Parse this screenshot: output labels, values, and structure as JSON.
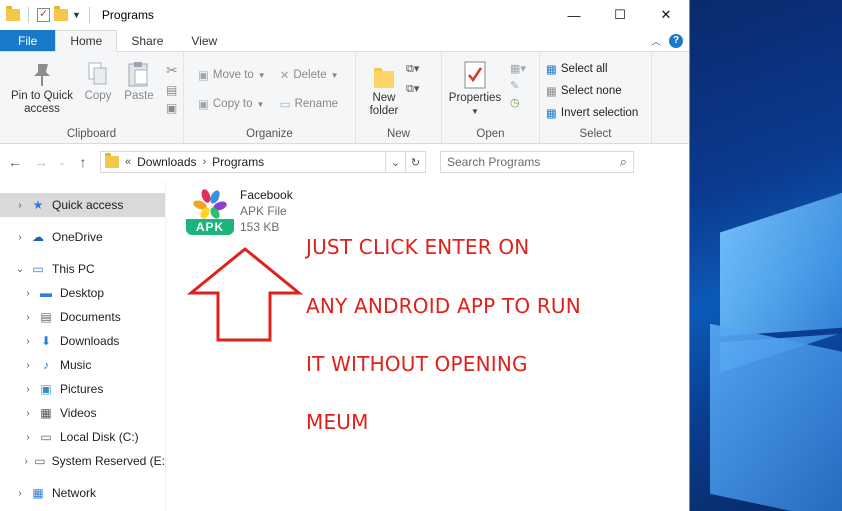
{
  "window": {
    "title": "Programs",
    "controls": {
      "minimize": "—",
      "maximize": "☐",
      "close": "✕"
    }
  },
  "tabs": [
    {
      "label": "File"
    },
    {
      "label": "Home"
    },
    {
      "label": "Share"
    },
    {
      "label": "View"
    }
  ],
  "ribbon": {
    "clipboard": {
      "label": "Clipboard",
      "pin": "Pin to Quick access",
      "copy": "Copy",
      "paste": "Paste"
    },
    "organize": {
      "label": "Organize",
      "move_to": "Move to",
      "copy_to": "Copy to",
      "delete": "Delete",
      "rename": "Rename"
    },
    "new": {
      "label": "New",
      "new_folder": "New folder"
    },
    "open": {
      "label": "Open",
      "properties": "Properties"
    },
    "select": {
      "label": "Select",
      "select_all": "Select all",
      "select_none": "Select none",
      "invert": "Invert selection"
    }
  },
  "address": {
    "prefix": "«",
    "crumbs": [
      "Downloads",
      "Programs"
    ],
    "search_placeholder": "Search Programs"
  },
  "nav": [
    {
      "label": "Quick access",
      "icon": "star-icon",
      "level": 0,
      "selected": true
    },
    {
      "label": "OneDrive",
      "icon": "cloud-icon",
      "level": 0
    },
    {
      "label": "This PC",
      "icon": "computer-icon",
      "level": 0,
      "expanded": true
    },
    {
      "label": "Desktop",
      "icon": "desktop-icon",
      "level": 1
    },
    {
      "label": "Documents",
      "icon": "documents-icon",
      "level": 1
    },
    {
      "label": "Downloads",
      "icon": "downloads-icon",
      "level": 1
    },
    {
      "label": "Music",
      "icon": "music-icon",
      "level": 1
    },
    {
      "label": "Pictures",
      "icon": "pictures-icon",
      "level": 1
    },
    {
      "label": "Videos",
      "icon": "videos-icon",
      "level": 1
    },
    {
      "label": "Local Disk (C:)",
      "icon": "drive-icon",
      "level": 1
    },
    {
      "label": "System Reserved (E:",
      "icon": "drive-icon",
      "level": 1
    },
    {
      "label": "Network",
      "icon": "network-icon",
      "level": 0
    }
  ],
  "file": {
    "name": "Facebook",
    "type": "APK File",
    "size": "153 KB",
    "icon_label": "APK"
  },
  "annotation": {
    "lines": [
      "JUST CLICK ENTER ON",
      "ANY ANDROID APP TO RUN",
      "IT WITHOUT OPENING",
      "MEUM"
    ],
    "color": "#e0211b"
  },
  "colors": {
    "accent": "#1979ca",
    "apk_green": "#1bb57a"
  }
}
